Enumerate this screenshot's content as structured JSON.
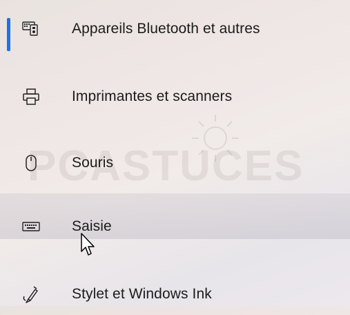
{
  "nav": {
    "items": [
      {
        "label": "Appareils Bluetooth et autres",
        "icon": "bluetooth-devices-icon",
        "selected": true
      },
      {
        "label": "Imprimantes et scanners",
        "icon": "printer-icon",
        "selected": false
      },
      {
        "label": "Souris",
        "icon": "mouse-icon",
        "selected": false
      },
      {
        "label": "Saisie",
        "icon": "keyboard-icon",
        "selected": false
      },
      {
        "label": "Stylet et Windows Ink",
        "icon": "pen-icon",
        "selected": false
      }
    ]
  },
  "watermark": {
    "text": "PCASTUCES"
  },
  "colors": {
    "accent": "#1a73e8",
    "text": "#1b1b1b"
  }
}
